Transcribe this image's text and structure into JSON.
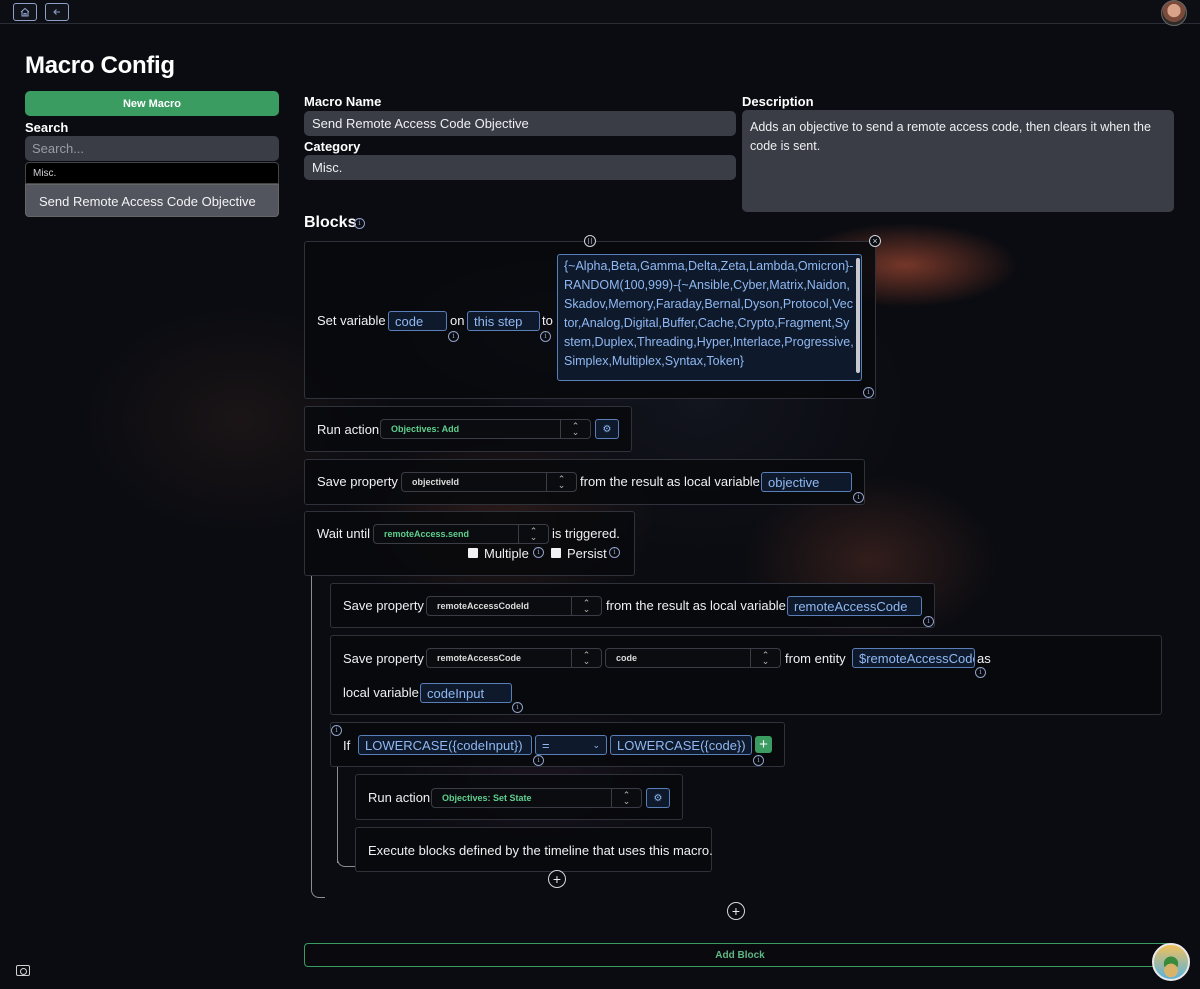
{
  "page": {
    "title": "Macro Config"
  },
  "sidebar": {
    "new_macro_label": "New Macro",
    "search_label": "Search",
    "search_placeholder": "Search...",
    "group_name": "Misc.",
    "items": [
      {
        "label": "Send Remote Access Code Objective"
      }
    ]
  },
  "form": {
    "macro_name_label": "Macro Name",
    "macro_name_value": "Send Remote Access Code Objective",
    "category_label": "Category",
    "category_value": "Misc.",
    "description_label": "Description",
    "description_value": "Adds an objective to send a remote access code, then clears it when the code is sent."
  },
  "blocks": {
    "title": "Blocks",
    "set_variable": {
      "label": "Set variable",
      "variable": "code",
      "on_text": "on",
      "scope": "this step",
      "to_text": "to",
      "value": "{~Alpha,Beta,Gamma,Delta,Zeta,Lambda,Omicron}-RANDOM(100,999)-{~Ansible,Cyber,Matrix,Naidon,Skadov,Memory,Faraday,Bernal,Dyson,Protocol,Vector,Analog,Digital,Buffer,Cache,Crypto,Fragment,System,Duplex,Threading,Hyper,Interlace,Progressive,Simplex,Multiplex,Syntax,Token}"
    },
    "run_action_1": {
      "label": "Run action",
      "action": "Objectives: Add"
    },
    "save_property_1": {
      "label": "Save property",
      "property": "objectiveId",
      "suffix": "from the result as local variable",
      "variable": "objective"
    },
    "wait_until": {
      "label": "Wait until",
      "trigger": "remoteAccess.send",
      "suffix": "is triggered.",
      "multiple_label": "Multiple",
      "persist_label": "Persist"
    },
    "save_property_2": {
      "label": "Save property",
      "property": "remoteAccessCodeId",
      "suffix": "from the result as local variable",
      "variable": "remoteAccessCode"
    },
    "save_property_3": {
      "label": "Save property",
      "property": "remoteAccessCode",
      "field": "code",
      "from_text": "from entity",
      "entity": "$remoteAccessCode",
      "as_text": "as",
      "local_label": "local variable",
      "variable": "codeInput"
    },
    "if_block": {
      "label": "If",
      "left": "LOWERCASE({codeInput})",
      "operator": "=",
      "right": "LOWERCASE({code})"
    },
    "run_action_2": {
      "label": "Run action",
      "action": "Objectives: Set State"
    },
    "execute_text": "Execute blocks defined by the timeline that uses this macro.",
    "add_block_label": "Add Block"
  },
  "icons": [
    "home-icon",
    "back-arrow-icon",
    "info-icon",
    "drag-handle-icon",
    "close-icon",
    "gear-icon",
    "chevron-updown-icon",
    "plus-icon",
    "camera-icon"
  ],
  "colors": {
    "accent_green": "#3b9c62",
    "input_blue": "#90b8f2",
    "field_bg": "#3a3d46"
  }
}
